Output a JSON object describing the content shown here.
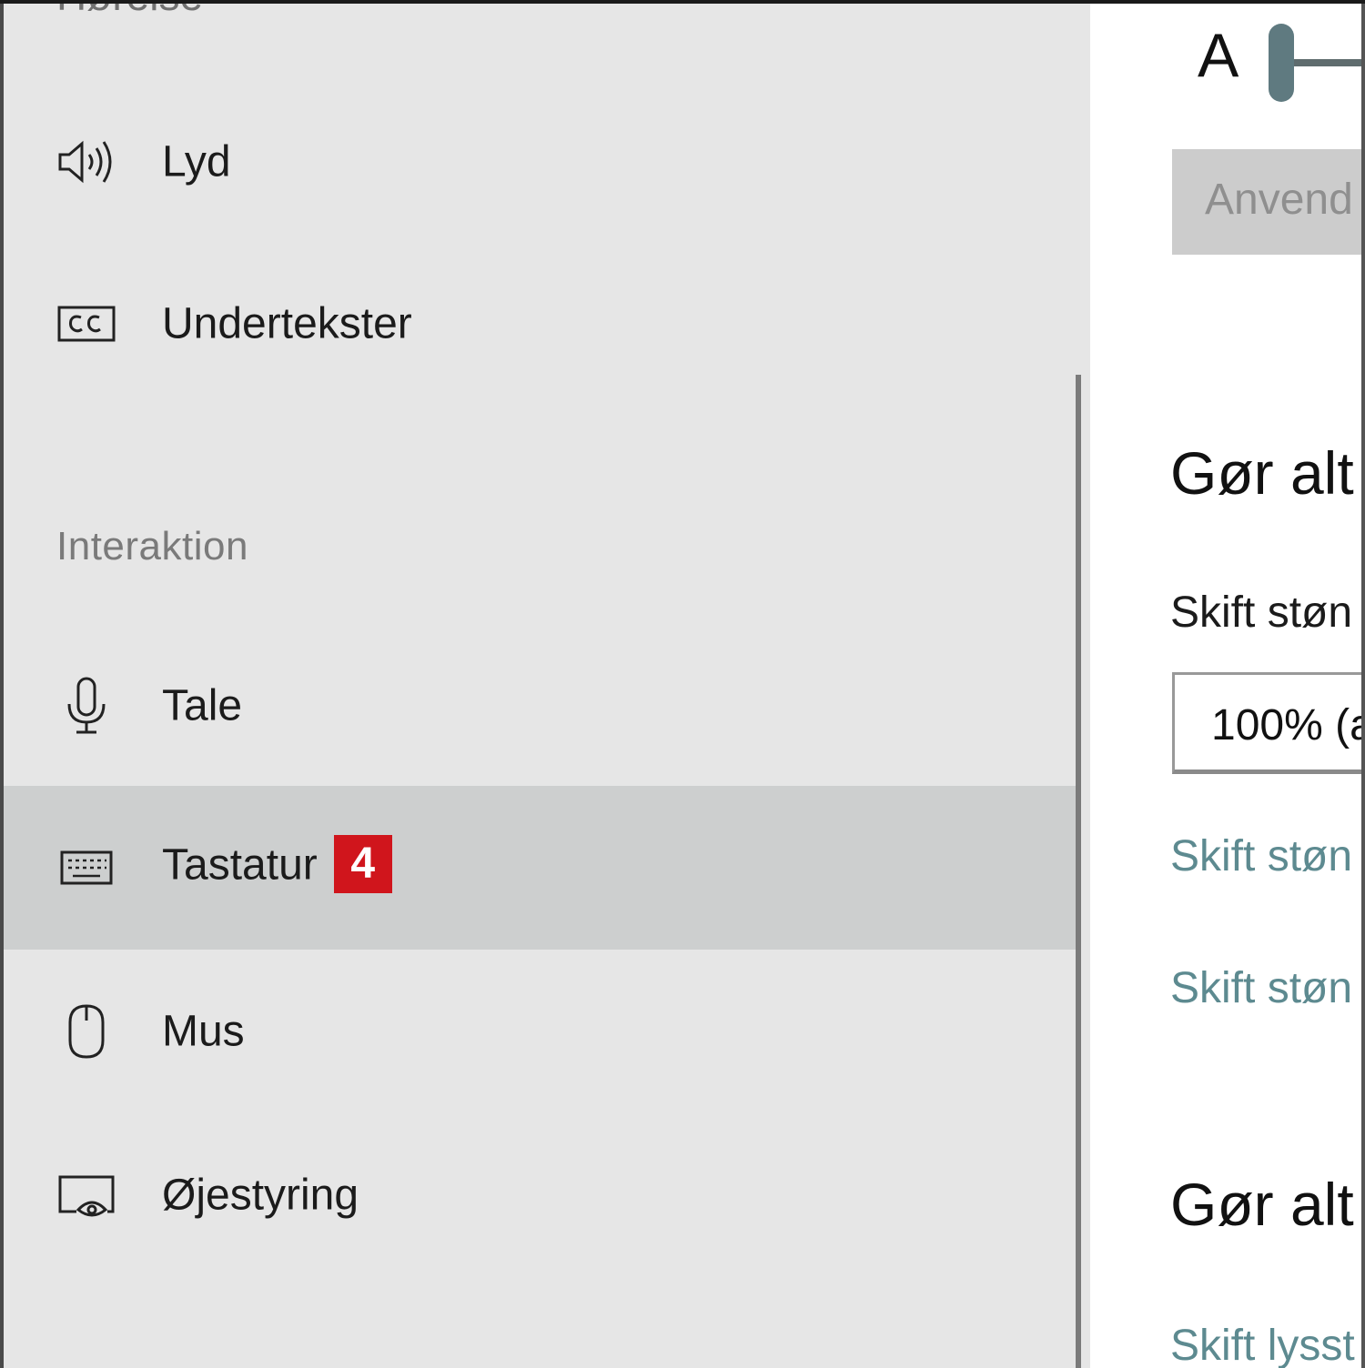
{
  "sidebar": {
    "cut_heading": "Hørelse",
    "items_hearing": [
      {
        "label": "Lyd",
        "icon": "speaker-icon"
      },
      {
        "label": "Undertekster",
        "icon": "closed-captions-icon"
      }
    ],
    "group_interaction": "Interaktion",
    "items_interaction": [
      {
        "label": "Tale",
        "icon": "microphone-icon"
      },
      {
        "label": "Tastatur",
        "icon": "keyboard-icon",
        "selected": true,
        "badge": "4"
      },
      {
        "label": "Mus",
        "icon": "mouse-icon"
      },
      {
        "label": "Øjestyring",
        "icon": "eye-control-icon"
      }
    ]
  },
  "content": {
    "slider_letter": "A",
    "apply_button": "Anvend",
    "section1_heading": "Gør alt",
    "size_label": "Skift støn",
    "size_dropdown_value": "100% (a",
    "link1": "Skift støn",
    "link2": "Skift støn",
    "section2_heading": "Gør alt",
    "link3": "Skift lysst"
  },
  "colors": {
    "sidebar_bg": "#e6e6e6",
    "selected_bg": "#cdcfcf",
    "badge_bg": "#d0151c",
    "link": "#5d8a90",
    "slider_thumb": "#5f7a80"
  }
}
